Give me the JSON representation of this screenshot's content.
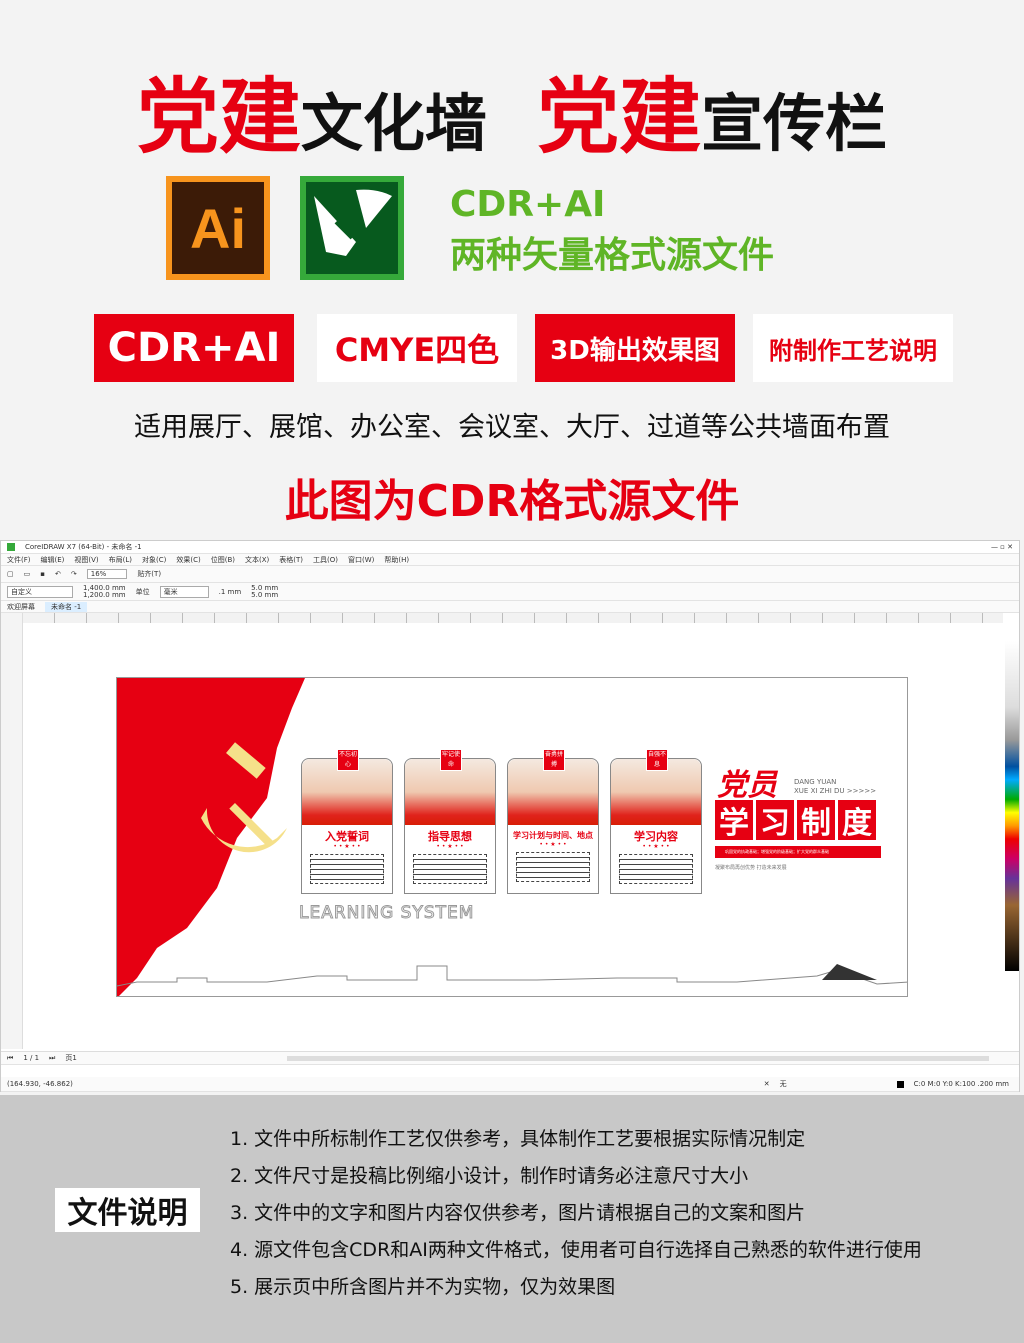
{
  "headline": {
    "part1_red": "党建",
    "part1_black": "文化墙",
    "part2_red": "党建",
    "part2_black": "宣传栏"
  },
  "icons": {
    "ai_label": "Ai",
    "ai_icon": "adobe-illustrator-icon",
    "cdr_icon": "coreldraw-icon"
  },
  "formats": {
    "line1": "CDR+AI",
    "line2": "两种矢量格式源文件"
  },
  "badges": [
    {
      "label": "CDR+AI",
      "style": "red"
    },
    {
      "label": "CMYE四色",
      "style": "white"
    },
    {
      "label": "3D输出效果图",
      "style": "red"
    },
    {
      "label": "附制作工艺说明",
      "style": "white"
    }
  ],
  "usage": "适用展厅、展馆、办公室、会议室、大厅、过道等公共墙面布置",
  "note": "此图为CDR格式源文件",
  "window": {
    "title": "CoreIDRAW X7 (64-Bit) - 未命名 -1",
    "menu": [
      "文件(F)",
      "编辑(E)",
      "视图(V)",
      "布局(L)",
      "对象(C)",
      "效果(C)",
      "位图(B)",
      "文本(X)",
      "表格(T)",
      "工具(O)",
      "窗口(W)",
      "帮助(H)"
    ],
    "zoom": "16%",
    "snap": "贴齐(T)",
    "page_preset": "自定义",
    "width": "1,400.0 mm",
    "height": "1,200.0 mm",
    "unit_label": "单位",
    "unit": "毫米",
    "nudge": ".1 mm",
    "dup_x": "5.0 mm",
    "dup_y": "5.0 mm",
    "tabs": [
      "欢迎屏幕",
      "未命名 -1"
    ],
    "page_nav": "1 / 1",
    "page_tab": "页1",
    "coords": "(164.930, -46.862)",
    "fill_status": "C:0 M:0 Y:0 K:100 .200 mm",
    "none_label": "无"
  },
  "artwork": {
    "cards": [
      {
        "tag": "不忘初心",
        "title": "入党誓词"
      },
      {
        "tag": "牢记使命",
        "title": "指导思想"
      },
      {
        "tag": "奋勇拼搏",
        "title": "学习计划与时间、地点"
      },
      {
        "tag": "自强不息",
        "title": "学习内容"
      }
    ],
    "watermark_text": "LEARNING SYSTEM",
    "title_top": "党员",
    "pinyin1": "DANG YUAN",
    "pinyin2": "XUE XI ZHI DU >>>>>",
    "title_main": [
      "学",
      "习",
      "制",
      "度"
    ],
    "slogan": "巩固党的执政基础；增强党的阶级基础；扩大党的群众基础",
    "sub": "凝聚布局再创优势 打造未来发展"
  },
  "doc": {
    "label": "文件说明",
    "items": [
      "1. 文件中所标制作工艺仅供参考，具体制作工艺要根据实际情况制定",
      "2. 文件尺寸是投稿比例缩小设计，制作时请务必注意尺寸大小",
      "3. 文件中的文字和图片内容仅供参考，图片请根据自己的文案和图片",
      "4. 源文件包含CDR和AI两种文件格式，使用者可自行选择自己熟悉的软件进行使用",
      "5. 展示页中所含图片并不为实物，仅为效果图"
    ]
  },
  "colors": {
    "red": "#e60012",
    "green": "#5fb526",
    "ai_orange": "#f7941d",
    "cdr_green": "#35a93a",
    "bottom_gray": "#c8c8c8"
  }
}
